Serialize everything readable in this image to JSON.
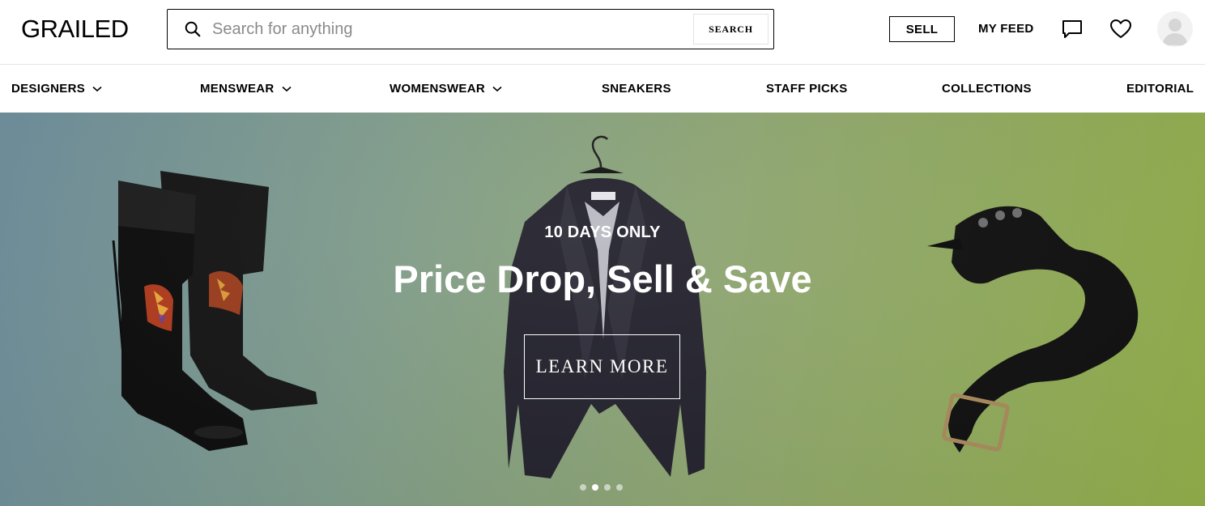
{
  "header": {
    "logo": "GRAILED",
    "search": {
      "placeholder": "Search for anything",
      "button_label": "SEARCH"
    },
    "sell_label": "SELL",
    "my_feed_label": "MY FEED"
  },
  "nav": {
    "items": [
      {
        "label": "DESIGNERS",
        "has_dropdown": true
      },
      {
        "label": "MENSWEAR",
        "has_dropdown": true
      },
      {
        "label": "WOMENSWEAR",
        "has_dropdown": true
      },
      {
        "label": "SNEAKERS",
        "has_dropdown": false
      },
      {
        "label": "STAFF PICKS",
        "has_dropdown": false
      },
      {
        "label": "COLLECTIONS",
        "has_dropdown": false
      },
      {
        "label": "EDITORIAL",
        "has_dropdown": false
      }
    ]
  },
  "hero": {
    "eyebrow": "10 DAYS ONLY",
    "title": "Price Drop, Sell & Save",
    "cta_label": "LEARN MORE",
    "carousel": {
      "slide_count": 4,
      "active_index": 1
    }
  },
  "colors": {
    "hero_gradient_start": "#6f8f9d",
    "hero_gradient_end": "#93b04a",
    "text_primary": "#000000",
    "hero_text": "#ffffff"
  },
  "icons": [
    "search-icon",
    "message-icon",
    "heart-icon",
    "avatar-icon",
    "chevron-down-icon"
  ]
}
